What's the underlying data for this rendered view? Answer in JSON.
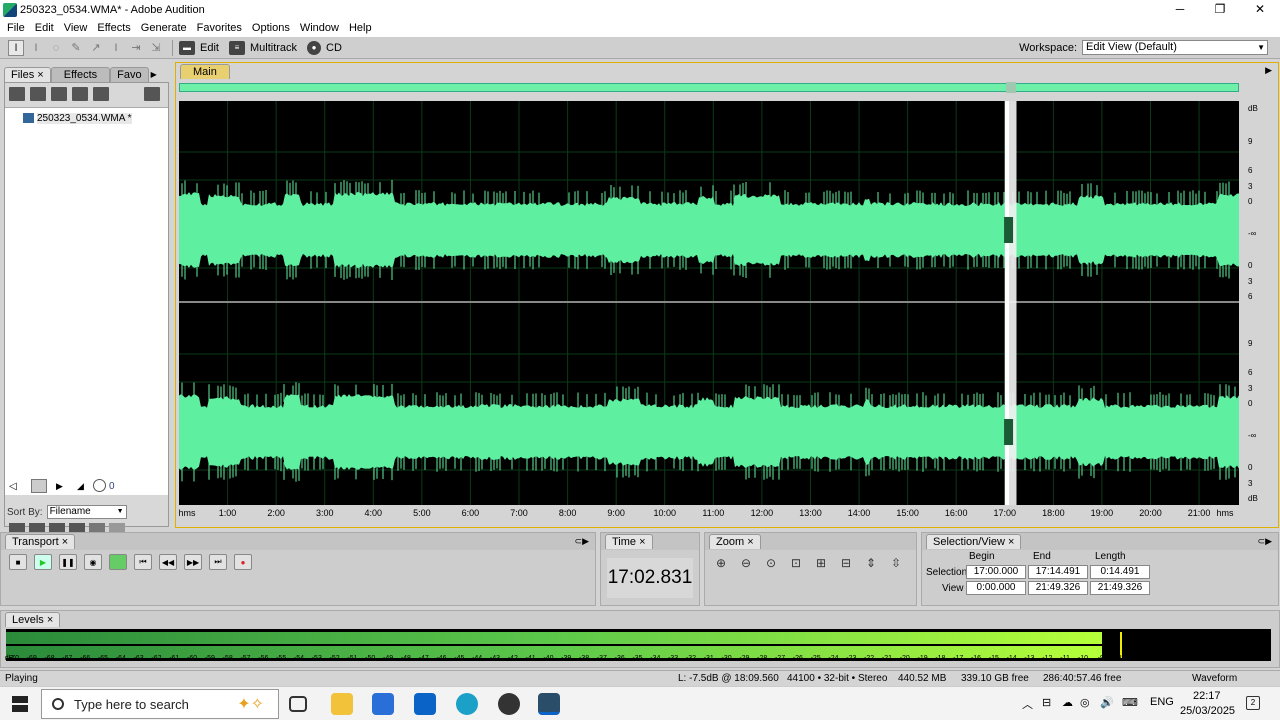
{
  "window": {
    "title": "250323_0534.WMA* - Adobe Audition",
    "min": "─",
    "max": "❐",
    "close": "✕"
  },
  "menu": [
    "File",
    "Edit",
    "View",
    "Effects",
    "Generate",
    "Favorites",
    "Options",
    "Window",
    "Help"
  ],
  "toolbar": {
    "modes": [
      "Edit",
      "Multitrack",
      "CD"
    ],
    "workspace_label": "Workspace:",
    "workspace_value": "Edit View (Default)"
  },
  "files_panel": {
    "tabs": [
      "Files",
      "Effects",
      "Favo"
    ],
    "files": [
      "250323_0534.WMA *"
    ],
    "sort_label": "Sort By:",
    "sort_value": "Filename",
    "vol_value": "0"
  },
  "main": {
    "tab": "Main",
    "db_labels_top": [
      "dB",
      "9",
      "6",
      "3",
      "0",
      "-∞",
      "0",
      "3",
      "6"
    ],
    "db_labels_bottom": [
      "9",
      "6",
      "3",
      "0",
      "-∞",
      "0",
      "3",
      "dB"
    ],
    "time_labels": [
      "hms",
      "1:00",
      "2:00",
      "3:00",
      "4:00",
      "5:00",
      "6:00",
      "7:00",
      "8:00",
      "9:00",
      "10:00",
      "11:00",
      "12:00",
      "13:00",
      "14:00",
      "15:00",
      "16:00",
      "17:00",
      "18:00",
      "19:00",
      "20:00",
      "21:00",
      "hms"
    ],
    "total_seconds": 1309.326,
    "selection_start_seconds": 1020.0,
    "selection_end_seconds": 1034.491,
    "playhead_seconds": 1022.831,
    "wave_color": "#5ef0a0"
  },
  "transport": {
    "title": "Transport"
  },
  "time": {
    "title": "Time",
    "value": "17:02.831"
  },
  "zoom": {
    "title": "Zoom"
  },
  "selection": {
    "title": "Selection/View",
    "col_begin": "Begin",
    "col_end": "End",
    "col_length": "Length",
    "row_selection": "Selection",
    "row_view": "View",
    "sel_begin": "17:00.000",
    "sel_end": "17:14.491",
    "sel_length": "0:14.491",
    "view_begin": "0:00.000",
    "view_end": "21:49.326",
    "view_length": "21:49.326"
  },
  "levels": {
    "title": "Levels",
    "level_db": -9,
    "peak_db": -8,
    "scale": [
      "dB",
      "-70",
      "-69",
      "-68",
      "-67",
      "-66",
      "-65",
      "-64",
      "-63",
      "-62",
      "-61",
      "-60",
      "-59",
      "-58",
      "-57",
      "-56",
      "-55",
      "-54",
      "-53",
      "-52",
      "-51",
      "-50",
      "-49",
      "-48",
      "-47",
      "-46",
      "-45",
      "-44",
      "-43",
      "-42",
      "-41",
      "-40",
      "-39",
      "-38",
      "-37",
      "-36",
      "-35",
      "-34",
      "-33",
      "-32",
      "-31",
      "-30",
      "-29",
      "-28",
      "-27",
      "-26",
      "-25",
      "-24",
      "-23",
      "-22",
      "-21",
      "-20",
      "-19",
      "-18",
      "-17",
      "-16",
      "-15",
      "-14",
      "-13",
      "-12",
      "-11",
      "-10",
      "-9",
      "-8",
      "-7",
      "-6",
      "-5",
      "-4",
      "-3",
      "-2",
      "-1",
      "0"
    ]
  },
  "status": {
    "state": "Playing",
    "level": "L: -7.5dB @  18:09.560",
    "format": "44100 • 32-bit • Stereo",
    "filesize": "440.52 MB",
    "free": "339.10 GB free",
    "free_time": "286:40:57.46 free",
    "view": "Waveform"
  },
  "taskbar": {
    "search_placeholder": "Type here to search",
    "lang": "ENG",
    "time": "22:17",
    "date": "25/03/2025",
    "notif": "2"
  }
}
